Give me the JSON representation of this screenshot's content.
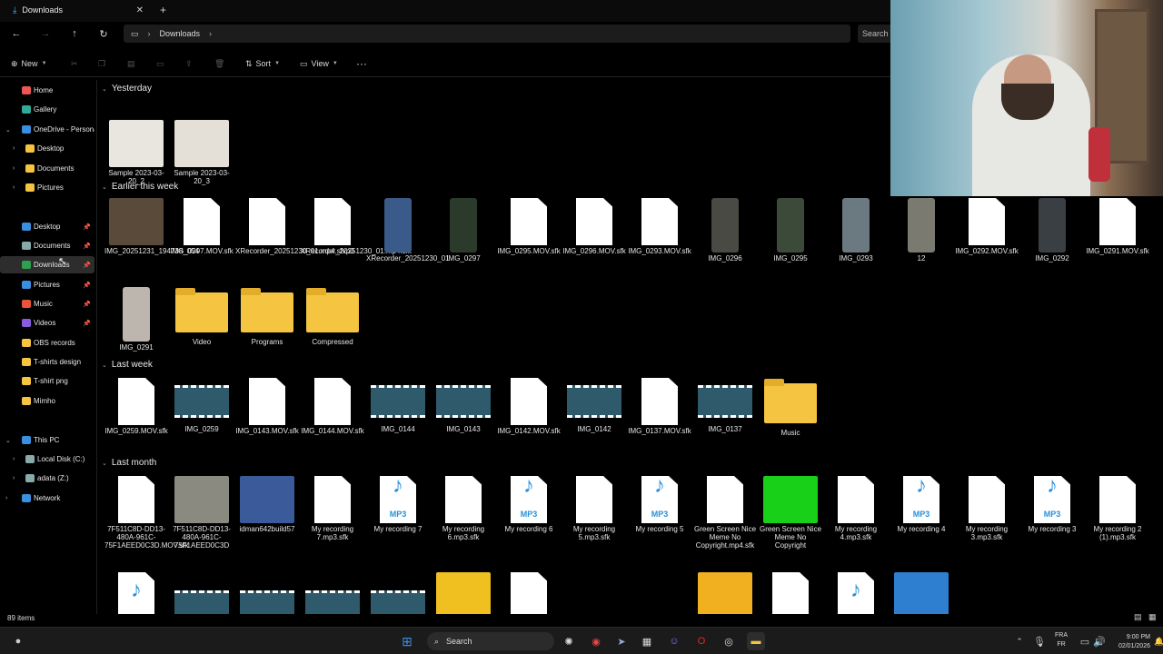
{
  "window": {
    "tab_title": "Downloads"
  },
  "nav": {
    "breadcrumb": "Downloads",
    "search_placeholder": "Search"
  },
  "command_bar": {
    "new_label": "New",
    "sort_label": "Sort",
    "view_label": "View",
    "more_label": "···"
  },
  "sidebar": {
    "items": [
      {
        "label": "Home",
        "icon": "home-icon",
        "color": "#e55"
      },
      {
        "label": "Gallery",
        "icon": "gallery-icon",
        "color": "#3a9"
      },
      {
        "label": "OneDrive - Persona",
        "icon": "cloud-icon",
        "color": "#3b8fe0"
      },
      {
        "label": "Desktop",
        "icon": "folder-icon",
        "color": "#f5c542"
      },
      {
        "label": "Documents",
        "icon": "folder-icon",
        "color": "#f5c542"
      },
      {
        "label": "Pictures",
        "icon": "folder-icon",
        "color": "#f5c542"
      },
      {
        "label": "Desktop",
        "icon": "desktop-icon",
        "color": "#3b8fe0"
      },
      {
        "label": "Documents",
        "icon": "documents-icon",
        "color": "#8aa"
      },
      {
        "label": "Downloads",
        "icon": "download-icon",
        "color": "#2ea04f"
      },
      {
        "label": "Pictures",
        "icon": "pictures-icon",
        "color": "#3b8fe0"
      },
      {
        "label": "Music",
        "icon": "music-icon",
        "color": "#e8553a"
      },
      {
        "label": "Videos",
        "icon": "videos-icon",
        "color": "#8a5be0"
      },
      {
        "label": "OBS records",
        "icon": "folder-icon",
        "color": "#f5c542"
      },
      {
        "label": "T-shirts design",
        "icon": "folder-icon",
        "color": "#f5c542"
      },
      {
        "label": "T-shirt png",
        "icon": "folder-icon",
        "color": "#f5c542"
      },
      {
        "label": "Mimho",
        "icon": "folder-icon",
        "color": "#f5c542"
      },
      {
        "label": "This PC",
        "icon": "pc-icon",
        "color": "#3b8fe0"
      },
      {
        "label": "Local Disk (C:)",
        "icon": "disk-icon",
        "color": "#8aa"
      },
      {
        "label": "adata (Z:)",
        "icon": "disk-icon",
        "color": "#8aa"
      },
      {
        "label": "Network",
        "icon": "network-icon",
        "color": "#3b8fe0"
      }
    ]
  },
  "groups": {
    "yesterday": "Yesterday",
    "earlier": "Earlier this week",
    "last_week": "Last week",
    "last_month": "Last month"
  },
  "files": {
    "yesterday": [
      "Sample 2023-03-20_2",
      "Sample 2023-03-20_3"
    ],
    "earlier_row1": [
      "IMG_20251231_194738_054",
      "IMG_0297.MOV.sfk",
      "XRecorder_20251230_01.mp4.sfvp0",
      "XRecorder_20251230_01.mp4.sfk",
      "XRecorder_20251230_01",
      "IMG_0297",
      "IMG_0295.MOV.sfk",
      "IMG_0296.MOV.sfk",
      "IMG_0293.MOV.sfk",
      "IMG_0296",
      "IMG_0295",
      "IMG_0293",
      "12",
      "IMG_0292.MOV.sfk",
      "IMG_0292",
      "IMG_0291.MOV.sfk"
    ],
    "earlier_row2": [
      "IMG_0291",
      "Video",
      "Programs",
      "Compressed"
    ],
    "last_week": [
      "IMG_0259.MOV.sfk",
      "IMG_0259",
      "IMG_0143.MOV.sfk",
      "IMG_0144.MOV.sfk",
      "IMG_0144",
      "IMG_0143",
      "IMG_0142.MOV.sfk",
      "IMG_0142",
      "IMG_0137.MOV.sfk",
      "IMG_0137",
      "Music"
    ],
    "last_month": [
      "7F511C8D-DD13-480A-961C-75F1AEED0C3D.MOV.sfk",
      "7F511C8D-DD13-480A-961C-75F1AEED0C3D",
      "idman642build57",
      "My recording 7.mp3.sfk",
      "My recording 7",
      "My recording 6.mp3.sfk",
      "My recording 6",
      "My recording 5.mp3.sfk",
      "My recording 5",
      "Green Screen Nice Meme No Copyright.mp4.sfk",
      "Green Screen Nice Meme No Copyright",
      "My recording 4.mp3.sfk",
      "My recording 4",
      "My recording 3.mp3.sfk",
      "My recording 3",
      "My recording 2 (1).mp3.sfk"
    ]
  },
  "status": {
    "count": "89 items"
  },
  "taskbar": {
    "search_label": "Search",
    "lang_top": "FRA",
    "lang_bottom": "FR",
    "time": "9:00 PM",
    "date": "02/01/2026"
  }
}
